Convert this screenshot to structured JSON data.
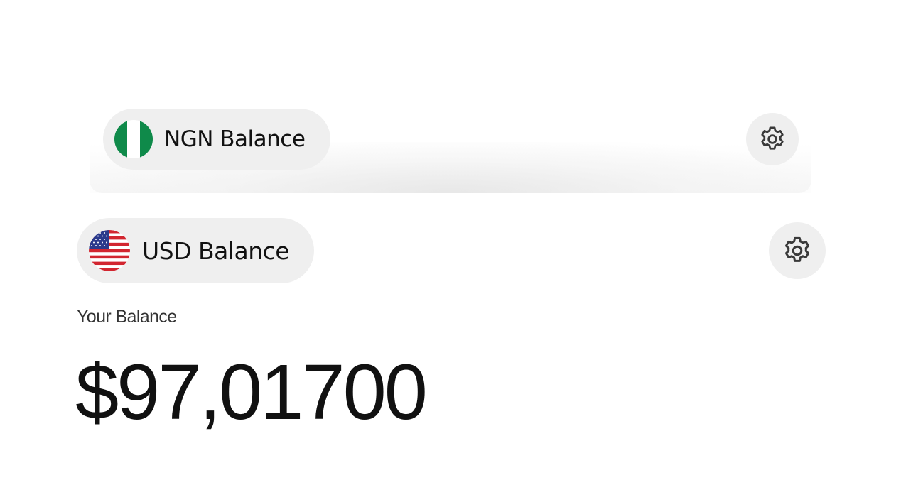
{
  "accounts": [
    {
      "currency_label": "NGN Balance",
      "flag_icon": "nigeria-flag-icon",
      "settings_icon": "gear-icon"
    },
    {
      "currency_label": "USD Balance",
      "flag_icon": "us-flag-icon",
      "settings_icon": "gear-icon"
    }
  ],
  "balance": {
    "label": "Your Balance",
    "amount": "$97,01700"
  },
  "colors": {
    "pill_background": "#efefef",
    "text_primary": "#111111",
    "text_secondary": "#333333",
    "nigeria_green": "#0f8a4a"
  }
}
